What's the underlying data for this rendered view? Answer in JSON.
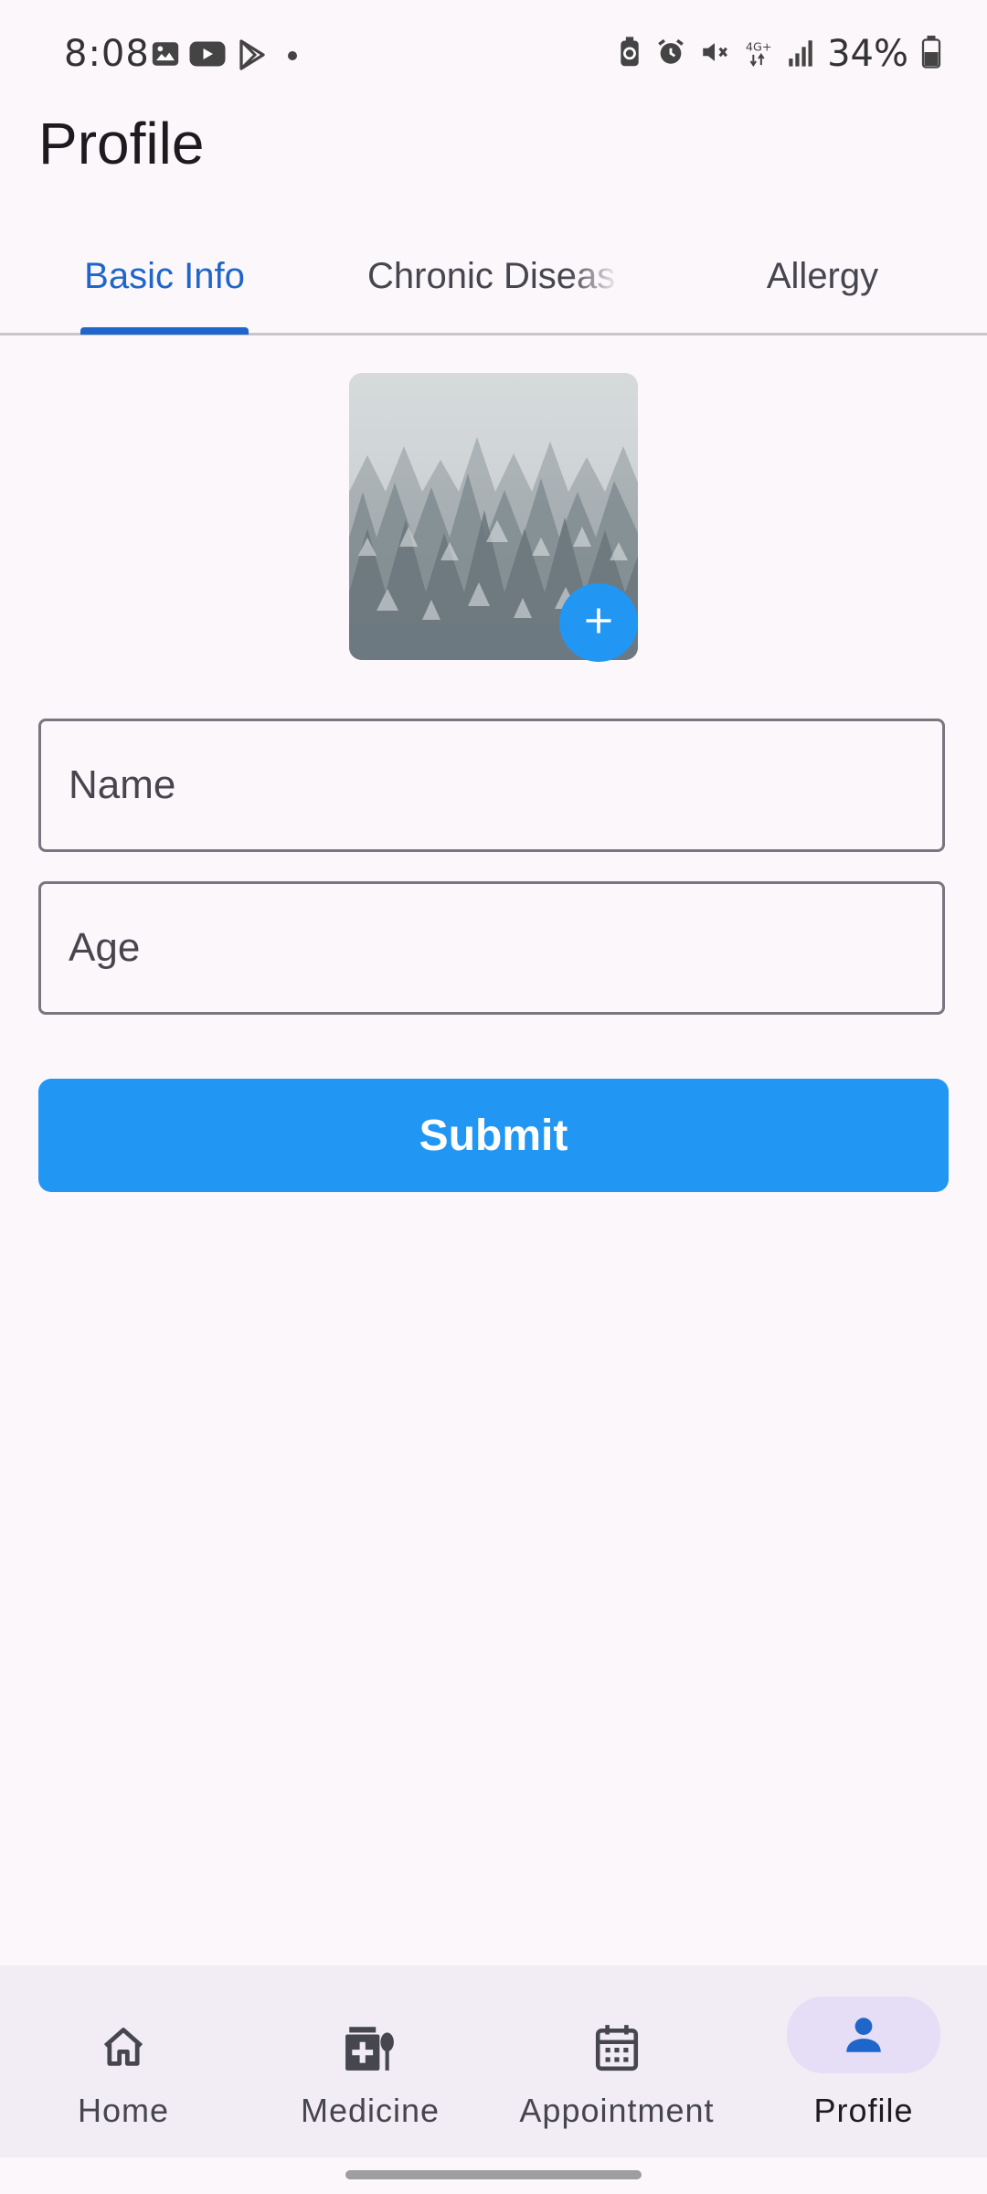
{
  "status_bar": {
    "time": "8:08",
    "battery": "34%",
    "network": "4G+",
    "left_icons": [
      "gallery-icon",
      "youtube-icon",
      "play-store-icon",
      "dot-icon"
    ],
    "right_icons": [
      "battery-saver-icon",
      "alarm-icon",
      "mute-icon",
      "4g-icon",
      "signal-icon",
      "battery-icon"
    ]
  },
  "header": {
    "title": "Profile"
  },
  "tabs": [
    {
      "label": "Basic Info",
      "active": true
    },
    {
      "label": "Chronic Diseas",
      "active": false
    },
    {
      "label": "Allergy",
      "active": false
    }
  ],
  "form": {
    "name_placeholder": "Name",
    "age_placeholder": "Age",
    "submit_label": "Submit",
    "add_photo_icon": "plus-icon"
  },
  "bottom_nav": {
    "items": [
      {
        "label": "Home",
        "icon": "home-icon",
        "active": false
      },
      {
        "label": "Medicine",
        "icon": "medicine-icon",
        "active": false
      },
      {
        "label": "Appointment",
        "icon": "calendar-icon",
        "active": false
      },
      {
        "label": "Profile",
        "icon": "person-icon",
        "active": true
      }
    ]
  },
  "colors": {
    "accent": "#2196f3",
    "tab_active": "#1e66c9",
    "background": "#fcf7fb",
    "nav_background": "#f2ecf4",
    "nav_active_pill": "#e6def6"
  }
}
